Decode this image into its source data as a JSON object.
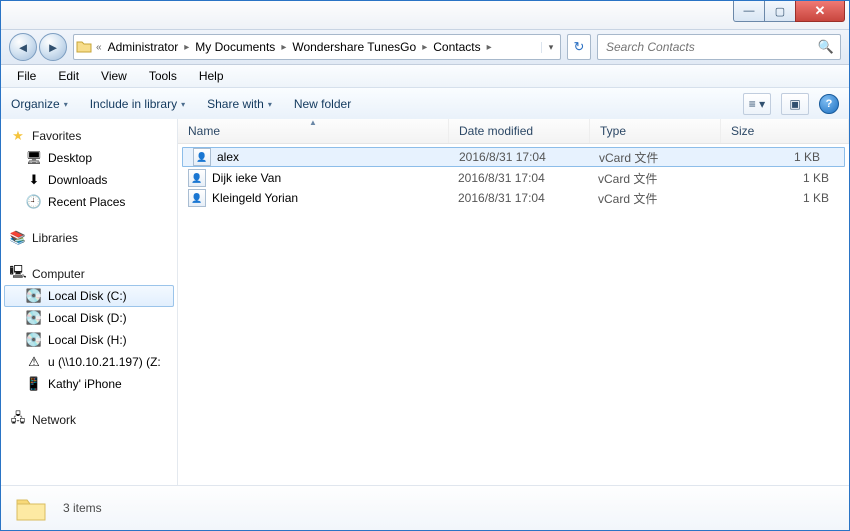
{
  "titlebar": {
    "min": "—",
    "max": "▢",
    "close": "✕"
  },
  "address": {
    "back": "◄",
    "forward": "►",
    "prefix": "«",
    "crumbs": [
      "Administrator",
      "My Documents",
      "Wondershare TunesGo",
      "Contacts"
    ],
    "sep": "▸",
    "dropdown": "▾",
    "refresh": "↻"
  },
  "search": {
    "placeholder": "Search Contacts",
    "icon": "🔍"
  },
  "menu": [
    "File",
    "Edit",
    "View",
    "Tools",
    "Help"
  ],
  "toolbar": {
    "organize": "Organize",
    "include": "Include in library",
    "share": "Share with",
    "newfolder": "New folder",
    "arr": "▾",
    "view": "≡",
    "preview": "▣",
    "help": "?"
  },
  "nav": {
    "favorites": {
      "label": "Favorites",
      "star": "★",
      "items": [
        {
          "icon": "🖥",
          "label": "Desktop"
        },
        {
          "icon": "⬇",
          "label": "Downloads"
        },
        {
          "icon": "🕘",
          "label": "Recent Places"
        }
      ]
    },
    "libraries": {
      "label": "Libraries",
      "icon": "📚"
    },
    "computer": {
      "label": "Computer",
      "icon": "🖳",
      "items": [
        {
          "icon": "💽",
          "label": "Local Disk (C:)",
          "selected": true
        },
        {
          "icon": "💽",
          "label": "Local Disk (D:)"
        },
        {
          "icon": "💽",
          "label": "Local Disk (H:)"
        },
        {
          "icon": "⚠",
          "label": "u (\\\\10.10.21.197) (Z:"
        },
        {
          "icon": "📱",
          "label": "Kathy' iPhone"
        }
      ]
    },
    "network": {
      "label": "Network",
      "icon": "🖧"
    }
  },
  "columns": {
    "name": "Name",
    "date": "Date modified",
    "type": "Type",
    "size": "Size",
    "sort": "▲"
  },
  "files": [
    {
      "name": "alex",
      "date": "2016/8/31 17:04",
      "type": "vCard 文件",
      "size": "1 KB",
      "selected": true
    },
    {
      "name": "Dijk ieke Van",
      "date": "2016/8/31 17:04",
      "type": "vCard 文件",
      "size": "1 KB"
    },
    {
      "name": "Kleingeld Yorian",
      "date": "2016/8/31 17:04",
      "type": "vCard 文件",
      "size": "1 KB"
    }
  ],
  "status": {
    "count": "3 items"
  }
}
